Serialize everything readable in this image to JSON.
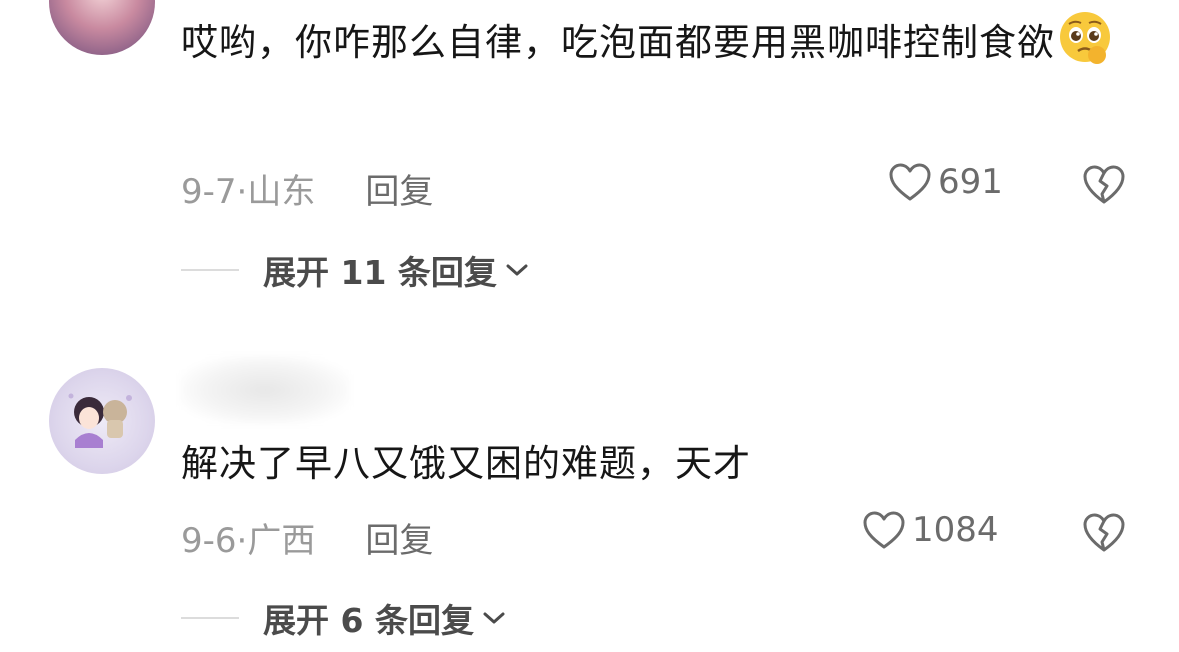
{
  "comments": [
    {
      "text": "哎哟，你咋那么自律，吃泡面都要用黑咖啡控制食欲",
      "emoji_icon": "pleading-face-emoji-icon",
      "date": "9-7·",
      "location": "山东",
      "reply_label": "回复",
      "likes": "691",
      "expand_label": "展开 11 条回复"
    },
    {
      "text": "解决了早八又饿又困的难题，天才",
      "date": "9-6·",
      "location": "广西",
      "reply_label": "回复",
      "likes": "1084",
      "expand_label": "展开 6 条回复"
    }
  ],
  "colors": {
    "text_primary": "#161616",
    "meta_gray": "#9a9a9a",
    "action_gray": "#6b6b6b"
  }
}
